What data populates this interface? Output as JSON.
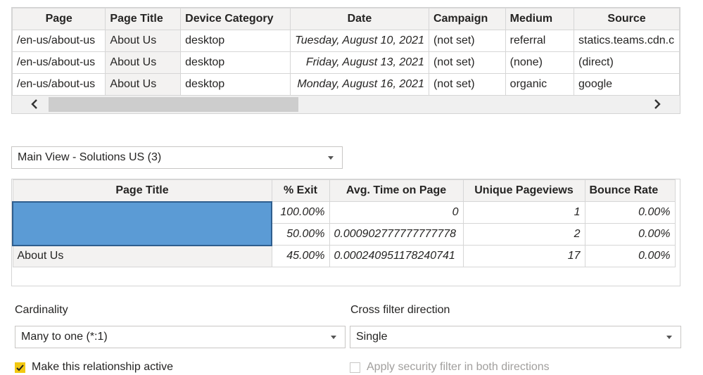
{
  "top_table": {
    "headers": [
      "Page",
      "Page Title",
      "Device Category",
      "Date",
      "Campaign",
      "Medium",
      "Source"
    ],
    "rows": [
      [
        "/en-us/about-us",
        "About Us",
        "desktop",
        "Tuesday, August 10, 2021",
        "(not set)",
        "referral",
        "statics.teams.cdn.c"
      ],
      [
        "/en-us/about-us",
        "About Us",
        "desktop",
        "Friday, August 13, 2021",
        "(not set)",
        "(none)",
        "(direct)"
      ],
      [
        "/en-us/about-us",
        "About Us",
        "desktop",
        "Monday, August 16, 2021",
        "(not set)",
        "organic",
        "google"
      ]
    ]
  },
  "view_select": {
    "value": "Main View - Solutions US (3)"
  },
  "second_table": {
    "headers": [
      "Page Title",
      "% Exit",
      "Avg. Time on Page",
      "Unique Pageviews",
      "Bounce Rate"
    ],
    "rows": [
      [
        "",
        "100.00%",
        "0",
        "1",
        "0.00%"
      ],
      [
        "",
        "50.00%",
        "0.000902777777777778",
        "2",
        "0.00%"
      ],
      [
        "About Us",
        "45.00%",
        "0.000240951178240741",
        "17",
        "0.00%"
      ]
    ]
  },
  "cardinality": {
    "label": "Cardinality",
    "value": "Many to one (*:1)"
  },
  "cross_filter": {
    "label": "Cross filter direction",
    "value": "Single"
  },
  "make_active": {
    "label": "Make this relationship active",
    "checked": true
  },
  "security_filter": {
    "label": "Apply security filter in both directions",
    "checked": false,
    "disabled": true
  },
  "colors": {
    "checkbox_accent": "#f2c811",
    "selection_blue": "#5b9bd5"
  },
  "icons": {
    "scroll_left": "chevron-left-icon",
    "scroll_right": "chevron-right-icon",
    "dropdown": "caret-down-icon",
    "check": "checkmark-icon"
  }
}
